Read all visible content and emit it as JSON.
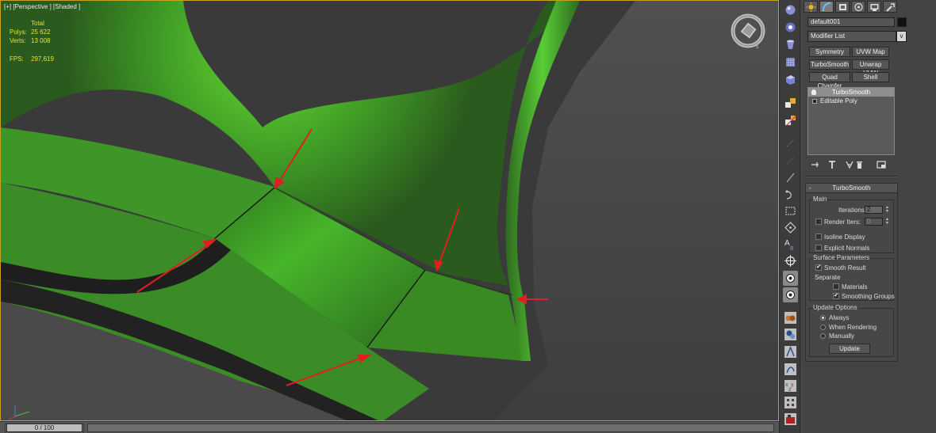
{
  "viewport": {
    "label": "[+] [Perspective ] [Shaded ]",
    "stats": {
      "header": "Total",
      "polys_label": "Polys:",
      "polys_value": "25 622",
      "verts_label": "Verts:",
      "verts_value": "13 008",
      "fps_label": "FPS:",
      "fps_value": "297,619"
    },
    "viewcube_icon": "viewcube-icon",
    "axis_icon": "axis-tripod-icon"
  },
  "timebar": {
    "frame": "0 / 100"
  },
  "toolstrip": {
    "icons": [
      "sphere-icon",
      "light-sphere-icon",
      "cylinder-icon",
      "grid-icon",
      "cube-icon",
      "link-icon",
      "unlink-icon",
      "dotted-line-icon",
      "dotted-line-icon",
      "line-icon",
      "connect-icon",
      "select-region-icon",
      "edge-icon",
      "vertex-icon",
      "text-abc-icon",
      "crosshair-icon",
      "view-icon",
      "view-icon",
      "teapot-icon",
      "teapot-icon",
      "bone-icon",
      "bone-icon",
      "bone-icon",
      "xyz-icon",
      "box-grid-icon",
      "render-icon"
    ]
  },
  "panel": {
    "tabs": [
      "create-icon",
      "modify-icon",
      "hierarchy-icon",
      "motion-icon",
      "display-icon",
      "utilities-icon"
    ],
    "object_name": "default001",
    "object_color": "#111111",
    "modifier_list": "Modifier List",
    "dropdown_arrow": "v",
    "modifier_buttons": [
      "Symmetry",
      "UVW Map",
      "TurboSmooth",
      "Unwrap UVW",
      "Quad Chamfer",
      "Shell"
    ],
    "stack": {
      "active": "TurboSmooth",
      "base": "Editable Poly"
    },
    "turbosmooth": {
      "title": "TurboSmooth",
      "collapse": "-",
      "main_title": "Main",
      "iterations_label": "Iterations:",
      "iterations_value": "2",
      "render_iters_label": "Render Iters:",
      "render_iters_value": "0",
      "render_iters_checked": false,
      "isoline_label": "Isoline Display",
      "isoline_checked": false,
      "explicit_label": "Explicit Normals",
      "explicit_checked": false,
      "surface_title": "Surface Parameters",
      "smooth_result_label": "Smooth Result",
      "smooth_result_checked": true,
      "separate_label": "Separate",
      "materials_label": "Materials",
      "materials_checked": false,
      "smoothing_groups_label": "Smoothing Groups",
      "smoothing_groups_checked": true,
      "update_title": "Update Options",
      "always_label": "Always",
      "when_rendering_label": "When Rendering",
      "manually_label": "Manually",
      "selected_update": "Always",
      "update_button": "Update",
      "check_mark": "✔"
    }
  },
  "colors": {
    "viewport_border": "#c8a21c",
    "stats_text": "#e8e04a",
    "mesh_green": "#4fc42f",
    "arrow_red": "#e02020"
  }
}
